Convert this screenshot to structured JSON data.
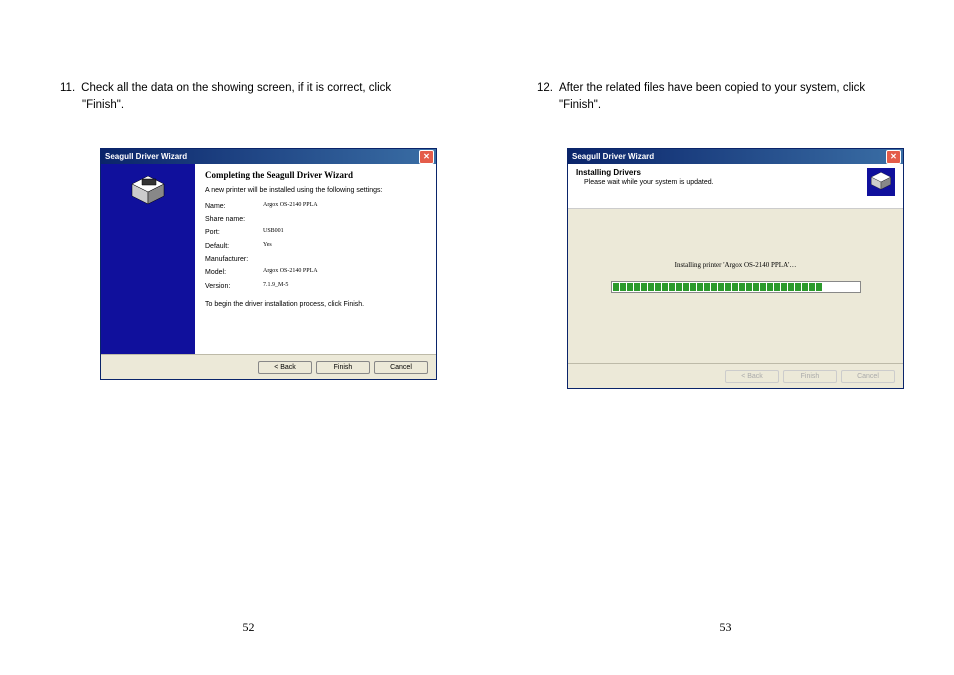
{
  "left": {
    "step_num": "11.",
    "step_line1": "Check all the data on the showing screen, if it is correct, click",
    "step_line2": "\"Finish\".",
    "pagenum": "52",
    "wizard": {
      "title": "Seagull Driver Wizard",
      "heading": "Completing the Seagull Driver Wizard",
      "sub": "A new printer will be installed using the following settings:",
      "rows": [
        {
          "label": "Name:",
          "value": "Argox OS-2140 PPLA"
        },
        {
          "label": "Share name:",
          "value": ""
        },
        {
          "label": "Port:",
          "value": "USB001"
        },
        {
          "label": "Default:",
          "value": "Yes"
        },
        {
          "label": "Manufacturer:",
          "value": ""
        },
        {
          "label": "Model:",
          "value": "Argox OS-2140 PPLA"
        },
        {
          "label": "Version:",
          "value": "7.1.9_M-5"
        }
      ],
      "note": "To begin the driver installation process, click Finish.",
      "buttons": {
        "back": "< Back",
        "finish": "Finish",
        "cancel": "Cancel"
      }
    }
  },
  "right": {
    "step_num": "12.",
    "step_line1": "After the related files have been copied to your system, click",
    "step_line2": "\"Finish\".",
    "pagenum": "53",
    "wizard": {
      "title": "Seagull Driver Wizard",
      "hdr_title": "Installing Drivers",
      "hdr_sub": "Please wait while your system is updated.",
      "install_text": "Installing printer 'Argox OS-2140 PPLA'…",
      "progress_segments": 30,
      "buttons": {
        "back": "< Back",
        "finish": "Finish",
        "cancel": "Cancel"
      }
    }
  }
}
